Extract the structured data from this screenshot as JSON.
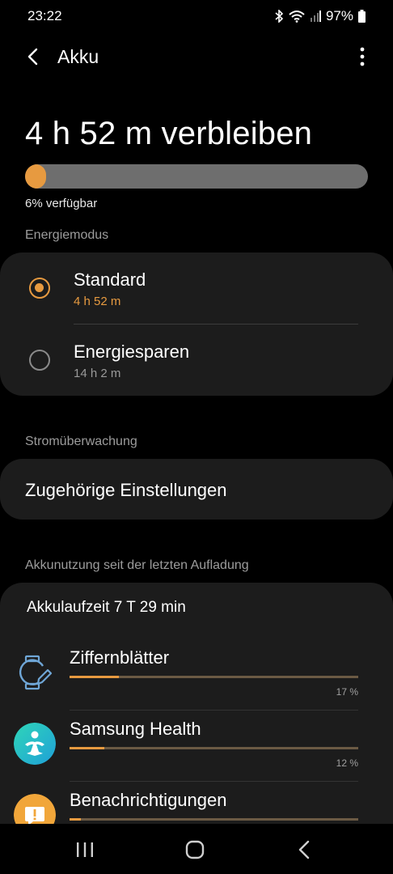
{
  "status": {
    "time": "23:22",
    "battery_pct": "97%",
    "icons": [
      "bluetooth-icon",
      "wifi-icon",
      "signal-icon",
      "battery-icon"
    ]
  },
  "appbar": {
    "title": "Akku",
    "back_icon": "back-arrow-icon",
    "menu_icon": "more-vertical-icon"
  },
  "battery": {
    "remaining": "4 h 52 m verbleiben",
    "level_fraction": 0.06,
    "available": "6% verfügbar",
    "fill_color": "#e79a40"
  },
  "power_mode": {
    "label": "Energiemodus",
    "options": [
      {
        "title": "Standard",
        "subtitle": "4 h 52 m",
        "selected": true
      },
      {
        "title": "Energiesparen",
        "subtitle": "14 h 2 m",
        "selected": false
      }
    ]
  },
  "power_monitor": {
    "label": "Stromüberwachung",
    "item": "Zugehörige Einstellungen"
  },
  "usage": {
    "label": "Akkunutzung seit der letzten Aufladung",
    "runtime": "Akkulaufzeit 7 T 29 min",
    "apps": [
      {
        "name": "Ziffernblätter",
        "percent": "17 %",
        "fraction": 0.17,
        "icon": "watch-face-edit-icon"
      },
      {
        "name": "Samsung Health",
        "percent": "12 %",
        "fraction": 0.12,
        "icon": "samsung-health-icon"
      },
      {
        "name": "Benachrichtigungen",
        "percent": "",
        "fraction": 0.04,
        "icon": "notification-alert-icon"
      }
    ]
  },
  "colors": {
    "accent": "#e79a40",
    "background": "#000000",
    "card": "#1c1c1c"
  },
  "nav": {
    "icons": [
      "recent-apps-icon",
      "home-icon",
      "back-icon"
    ]
  }
}
